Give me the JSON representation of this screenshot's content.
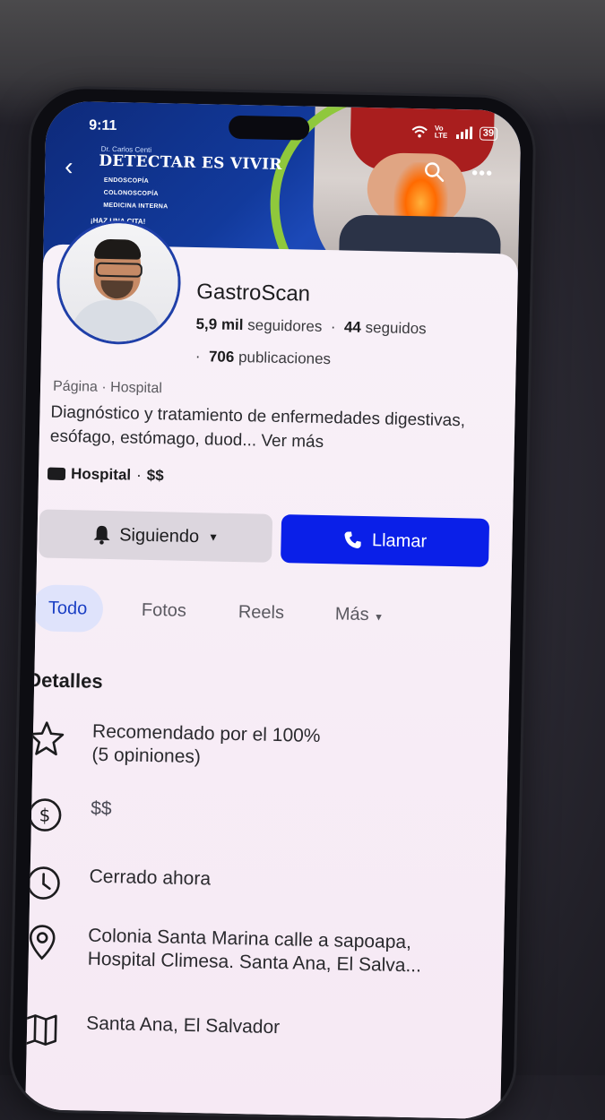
{
  "status_bar": {
    "time": "9:11",
    "network": "Vo LTE",
    "battery": "39"
  },
  "cover": {
    "kicker": "Dr. Carlos Centi",
    "headline": "DETECTAR ES VIVIR",
    "services": [
      "ENDOSCOPÍA",
      "COLONOSCOPÍA",
      "MEDICINA INTERNA"
    ],
    "cta": "¡HAZ UNA CITA!"
  },
  "profile": {
    "name": "GastroScan",
    "followers_count": "5,9 mil",
    "followers_label": "seguidores",
    "following_count": "44",
    "following_label": "seguidos",
    "posts_count": "706",
    "posts_label": "publicaciones",
    "category_line": "Página · Hospital",
    "description": "Diagnóstico y tratamiento de enfermedades digestivas, esófago, estómago, duod...",
    "see_more": "Ver más",
    "tag_category": "Hospital",
    "tag_price": "$$"
  },
  "actions": {
    "follow_label": "Siguiendo",
    "call_label": "Llamar"
  },
  "tabs": [
    {
      "label": "Todo",
      "active": true
    },
    {
      "label": "Fotos"
    },
    {
      "label": "Reels"
    },
    {
      "label": "Más"
    }
  ],
  "details": {
    "title": "Detalles",
    "items": [
      {
        "icon": "star-icon",
        "text": "Recomendado por el 100%\n(5 opiniones)"
      },
      {
        "icon": "dollar-icon",
        "text": "$$"
      },
      {
        "icon": "clock-icon",
        "text": "Cerrado ahora"
      },
      {
        "icon": "location-pin-icon",
        "text": "Colonia Santa Marina calle a sapoapa,\nHospital Climesa. Santa Ana, El Salva..."
      },
      {
        "icon": "map-icon",
        "text": "Santa Ana, El Salvador"
      }
    ]
  },
  "colors": {
    "primary": "#0a1fe8",
    "tab_active_bg": "#dfe3fb",
    "tab_active_text": "#1a3fc4"
  }
}
